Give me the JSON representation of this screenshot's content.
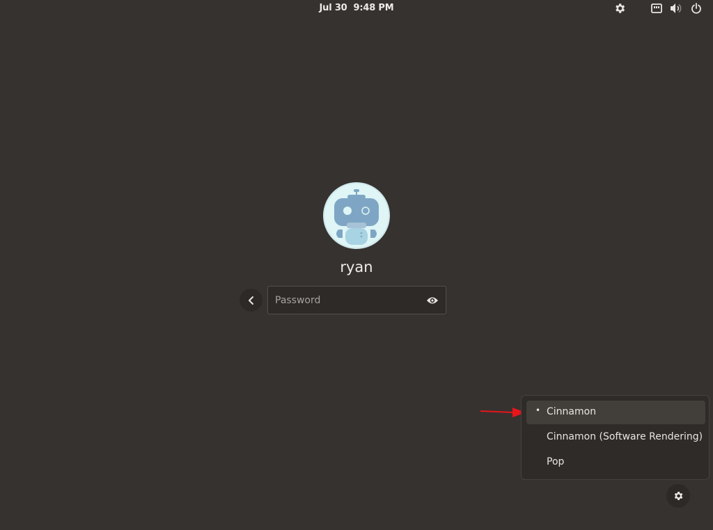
{
  "topbar": {
    "date": "Jul 30",
    "time": "9:48 PM",
    "icons": [
      "settings-icon",
      "network-wired-icon",
      "volume-icon",
      "power-icon"
    ]
  },
  "login": {
    "username": "ryan",
    "password_placeholder": "Password",
    "avatar": "robot-avatar"
  },
  "session_menu": {
    "items": [
      {
        "label": "Cinnamon",
        "selected": true,
        "bullet": "•"
      },
      {
        "label": "Cinnamon (Software Rendering)",
        "selected": false,
        "bullet": ""
      },
      {
        "label": "Pop",
        "selected": false,
        "bullet": ""
      }
    ],
    "gear_icon": "gear-icon"
  },
  "colors": {
    "background": "#36322f",
    "highlight": "#423e3a",
    "annotation_arrow": "#e8141c",
    "avatar_bg": "#dff5f6",
    "robot": "#7ea6c4"
  }
}
